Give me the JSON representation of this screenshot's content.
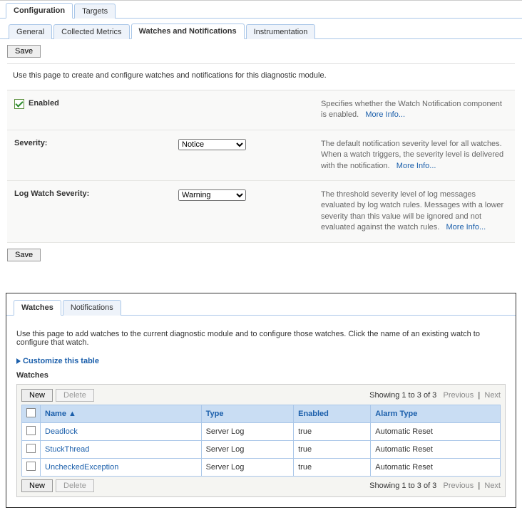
{
  "topTabs": {
    "configuration": "Configuration",
    "targets": "Targets"
  },
  "subTabs": {
    "general": "General",
    "collectedMetrics": "Collected Metrics",
    "watchesNotifications": "Watches and Notifications",
    "instrumentation": "Instrumentation"
  },
  "buttons": {
    "save": "Save",
    "new": "New",
    "delete": "Delete"
  },
  "pageDesc": "Use this page to create and configure watches and notifications for this diagnostic module.",
  "form": {
    "enabled": {
      "label": "Enabled",
      "help": "Specifies whether the Watch Notification component is enabled.",
      "moreInfo": "More Info..."
    },
    "severity": {
      "label": "Severity:",
      "value": "Notice",
      "help": "The default notification severity level for all watches. When a watch triggers, the severity level is delivered with the notification.",
      "moreInfo": "More Info..."
    },
    "logWatchSeverity": {
      "label": "Log Watch Severity:",
      "value": "Warning",
      "help": "The threshold severity level of log messages evaluated by log watch rules. Messages with a lower severity than this value will be ignored and not evaluated against the watch rules.",
      "moreInfo": "More Info..."
    }
  },
  "panelTabs": {
    "watches": "Watches",
    "notifications": "Notifications"
  },
  "panelDesc": "Use this page to add watches to the current diagnostic module and to configure those watches. Click the name of an existing watch to configure that watch.",
  "customize": "Customize this table",
  "tableTitle": "Watches",
  "pager": {
    "showing": "Showing 1 to 3 of 3",
    "previous": "Previous",
    "next": "Next"
  },
  "columns": {
    "name": "Name",
    "type": "Type",
    "enabled": "Enabled",
    "alarmType": "Alarm Type"
  },
  "rows": [
    {
      "name": "Deadlock",
      "type": "Server Log",
      "enabled": "true",
      "alarmType": "Automatic Reset"
    },
    {
      "name": "StuckThread",
      "type": "Server Log",
      "enabled": "true",
      "alarmType": "Automatic Reset"
    },
    {
      "name": "UncheckedException",
      "type": "Server Log",
      "enabled": "true",
      "alarmType": "Automatic Reset"
    }
  ]
}
